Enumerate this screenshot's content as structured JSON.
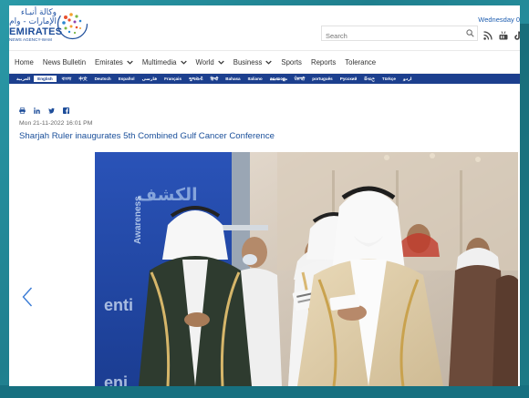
{
  "header": {
    "logo_arabic_line1": "وكالة أنبـاء",
    "logo_arabic_line2": "الإمارات - وام",
    "logo_name": "EMIRATES",
    "logo_sub": "NEWS AGENCY-WAM",
    "date": "Wednesday 0",
    "search_placeholder": "Search"
  },
  "social_icons": [
    "rss-icon",
    "youtube-icon",
    "tiktok-icon"
  ],
  "nav": {
    "items": [
      {
        "label": "Home",
        "dropdown": false
      },
      {
        "label": "News Bulletin",
        "dropdown": false
      },
      {
        "label": "Emirates",
        "dropdown": true
      },
      {
        "label": "Multimedia",
        "dropdown": true
      },
      {
        "label": "World",
        "dropdown": true
      },
      {
        "label": "Business",
        "dropdown": true
      },
      {
        "label": "Sports",
        "dropdown": false
      },
      {
        "label": "Reports",
        "dropdown": false
      },
      {
        "label": "Tolerance",
        "dropdown": false
      }
    ]
  },
  "languages": {
    "active": "English",
    "items": [
      "العربية",
      "English",
      "বাংলা",
      "中文",
      "Deutsch",
      "Español",
      "فارسی",
      "Français",
      "ગુજરાતી",
      "हिन्दी",
      "Bahasa",
      "Italiano",
      "മലയാളം",
      "ਪੰਜਾਬੀ",
      "português",
      "Русский",
      "සිංහල",
      "Türkçe",
      "اردو"
    ]
  },
  "article": {
    "share_icons": [
      "print-icon",
      "linkedin-icon",
      "twitter-icon",
      "facebook-icon"
    ],
    "timestamp": "Mon 21-11-2022 16:01 PM",
    "headline": "Sharjah Ruler inaugurates 5th Combined Gulf Cancer Conference",
    "photo_banner_arabic": "الكشف",
    "photo_banner_awareness": "Awareness",
    "photo_banner_text1": "enti",
    "photo_banner_text2": "eni"
  },
  "colors": {
    "brand_blue": "#1d4d9a",
    "headline_blue": "#1a4f9a",
    "language_bar": "#1c3f8e",
    "background_teal": "#2a9aa8"
  }
}
